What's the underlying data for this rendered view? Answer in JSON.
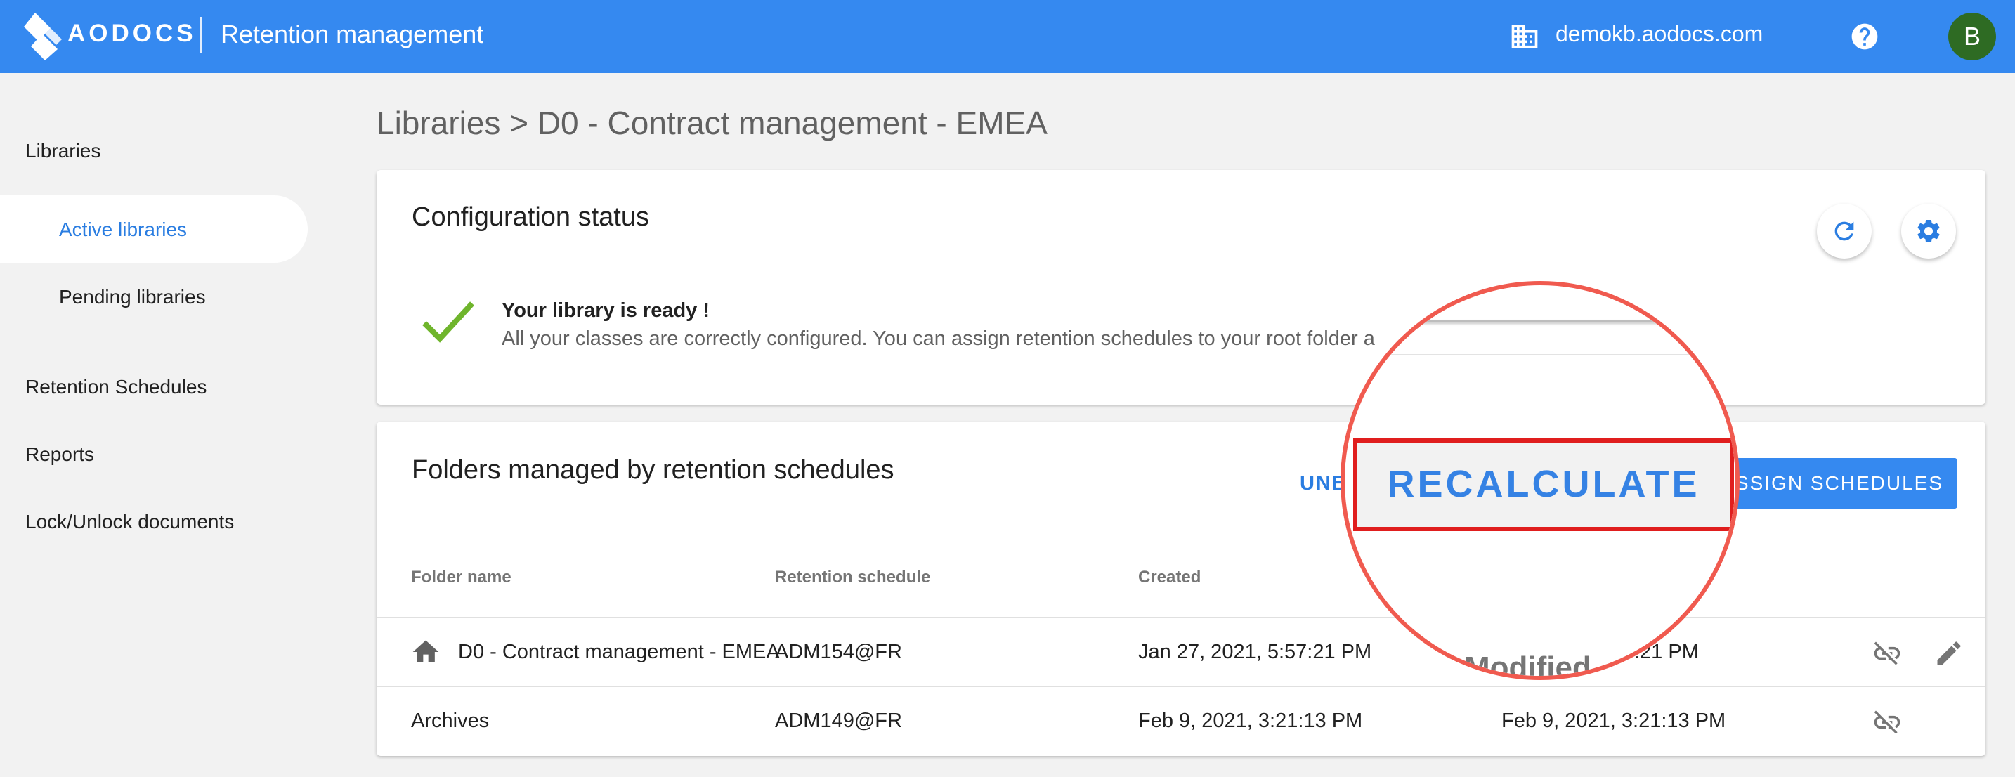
{
  "header": {
    "logo_text": "AODOCS",
    "app_title": "Retention management",
    "domain": "demokb.aodocs.com",
    "avatar_initial": "B",
    "brand_color": "#3589f0"
  },
  "sidebar": {
    "items": [
      {
        "label": "Libraries"
      },
      {
        "label": "Active libraries",
        "active": true
      },
      {
        "label": "Pending libraries"
      },
      {
        "label": "Retention Schedules"
      },
      {
        "label": "Reports"
      },
      {
        "label": "Lock/Unlock documents"
      }
    ]
  },
  "breadcrumb": "Libraries > D0 - Contract management - EMEA",
  "config_card": {
    "title": "Configuration status",
    "status_title": "Your library is ready !",
    "status_desc": "All your classes are correctly configured. You can assign retention schedules to your root folder a",
    "icons": [
      "refresh-icon",
      "gear-icon",
      "check-icon"
    ]
  },
  "folders_card": {
    "title": "Folders managed by retention schedules",
    "unbind_label": "UNB",
    "assign_label": "ASSIGN SCHEDULES",
    "columns": [
      "Folder name",
      "Retention schedule",
      "Created"
    ],
    "rows": [
      {
        "name": "D0 - Contract management - EMEA",
        "schedule": "ADM154@FR",
        "created": "Jan 27, 2021, 5:57:21 PM",
        "modified": ":21 PM",
        "icon": "home-icon",
        "editable": true
      },
      {
        "name": "Archives",
        "schedule": "ADM149@FR",
        "created": "Feb 9, 2021, 3:21:13 PM",
        "modified": "Feb 9, 2021, 3:21:13 PM",
        "editable": false
      }
    ]
  },
  "magnifier": {
    "button_label": "RECALCULATE",
    "column_label": "Modified"
  }
}
